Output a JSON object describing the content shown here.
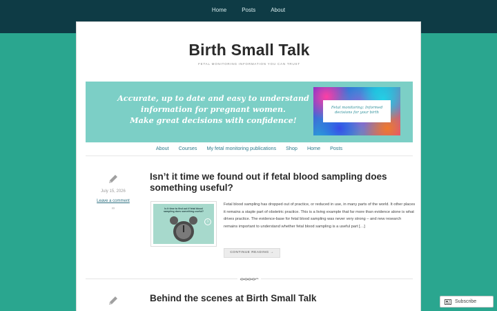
{
  "top_nav": [
    "Home",
    "Posts",
    "About"
  ],
  "site": {
    "title": "Birth Small Talk",
    "tagline": "FETAL MONITORING INFORMATION YOU CAN TRUST"
  },
  "banner": {
    "lines": [
      "Accurate, up to date and easy to understand",
      "information for pregnant women.",
      "Make great decisions with confidence!"
    ],
    "card_text": "Fetal monitoring: Informed decisions for your birth"
  },
  "main_nav": [
    "About",
    "Courses",
    "My fetal monitoring publications",
    "Shop",
    "Home",
    "Posts"
  ],
  "posts": [
    {
      "date": "July 15, 2026",
      "comment_link": "Leave a comment",
      "infinity": "∞",
      "title": "Isn’t it time we found out if fetal blood sampling does something useful?",
      "thumb_text": "Is it time to find out if fetal blood sampling does something useful?",
      "excerpt": "Fetal blood sampling has dropped out of practice, or reduced in use, in many parts of the world. It other places it remains a staple part of obstetric practice. This is a living example that far more than evidence alone is what drives practice. The evidence-base for fetal blood sampling was never very strong – and new research remains important to understand whether fetal blood sampling is a useful part […]",
      "continue_label": "CONTINUE READING →"
    },
    {
      "title": "Behind the scenes at Birth Small Talk"
    }
  ],
  "subscribe": {
    "label": "Subscribe"
  },
  "colors": {
    "topbar": "#0e3b45",
    "background": "#2aa68f",
    "banner": "#7ccfc6",
    "link": "#2c7a8c"
  },
  "icons": {
    "post_format": "pencil-icon",
    "subscribe": "reader-icon",
    "divider": "ornament-icon"
  }
}
